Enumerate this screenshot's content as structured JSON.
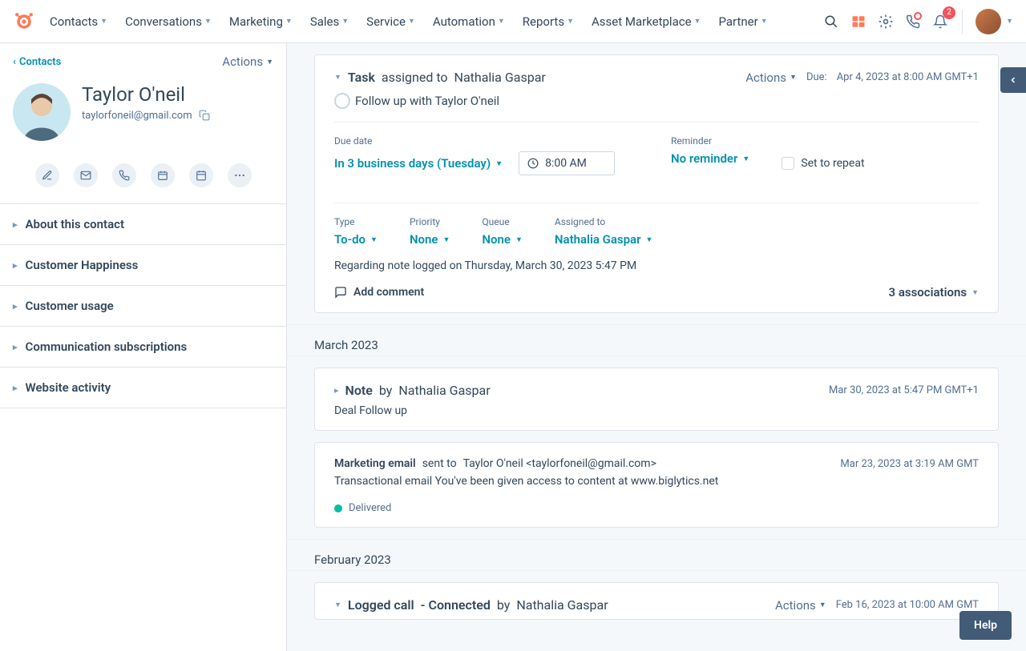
{
  "topnav": {
    "items": [
      "Contacts",
      "Conversations",
      "Marketing",
      "Sales",
      "Service",
      "Automation",
      "Reports",
      "Asset Marketplace",
      "Partner"
    ],
    "notification_count": "2"
  },
  "sidebar": {
    "back_label": "Contacts",
    "actions_label": "Actions",
    "contact": {
      "name": "Taylor O'neil",
      "email": "taylorfoneil@gmail.com"
    },
    "sections": [
      "About this contact",
      "Customer Happiness",
      "Customer usage",
      "Communication subscriptions",
      "Website activity"
    ]
  },
  "task_card": {
    "type_label": "Task",
    "assigned_prefix": "assigned to",
    "assigned_to": "Nathalia Gaspar",
    "actions_label": "Actions",
    "due_label": "Due:",
    "due_value": "Apr 4, 2023 at 8:00 AM GMT+1",
    "title": "Follow up with Taylor O'neil",
    "due_date_label": "Due date",
    "due_date_value": "In 3 business days (Tuesday)",
    "time_value": "8:00 AM",
    "reminder_label": "Reminder",
    "reminder_value": "No reminder",
    "repeat_label": "Set to repeat",
    "meta": {
      "type_label": "Type",
      "type_value": "To-do",
      "priority_label": "Priority",
      "priority_value": "None",
      "queue_label": "Queue",
      "queue_value": "None",
      "assigned_label": "Assigned to",
      "assigned_value": "Nathalia Gaspar"
    },
    "regarding": "Regarding note logged on Thursday, March 30, 2023 5:47 PM",
    "add_comment_label": "Add comment",
    "associations_label": "3 associations"
  },
  "timeline": {
    "march_header": "March 2023",
    "note": {
      "type_label": "Note",
      "by_prefix": "by",
      "author": "Nathalia Gaspar",
      "timestamp": "Mar 30, 2023 at 5:47 PM GMT+1",
      "body": "Deal Follow up"
    },
    "marketing": {
      "type_label": "Marketing email",
      "sent_prefix": "sent to",
      "recipient": "Taylor O'neil <taylorfoneil@gmail.com>",
      "timestamp": "Mar 23, 2023 at 3:19 AM GMT",
      "body": "Transactional email You've been given access to content at www.biglytics.net",
      "status": "Delivered"
    },
    "february_header": "February 2023",
    "call": {
      "type_label": "Logged call",
      "outcome": "- Connected",
      "by_prefix": "by",
      "author": "Nathalia Gaspar",
      "actions_label": "Actions",
      "timestamp": "Feb 16, 2023 at 10:00 AM GMT"
    }
  },
  "help_label": "Help"
}
